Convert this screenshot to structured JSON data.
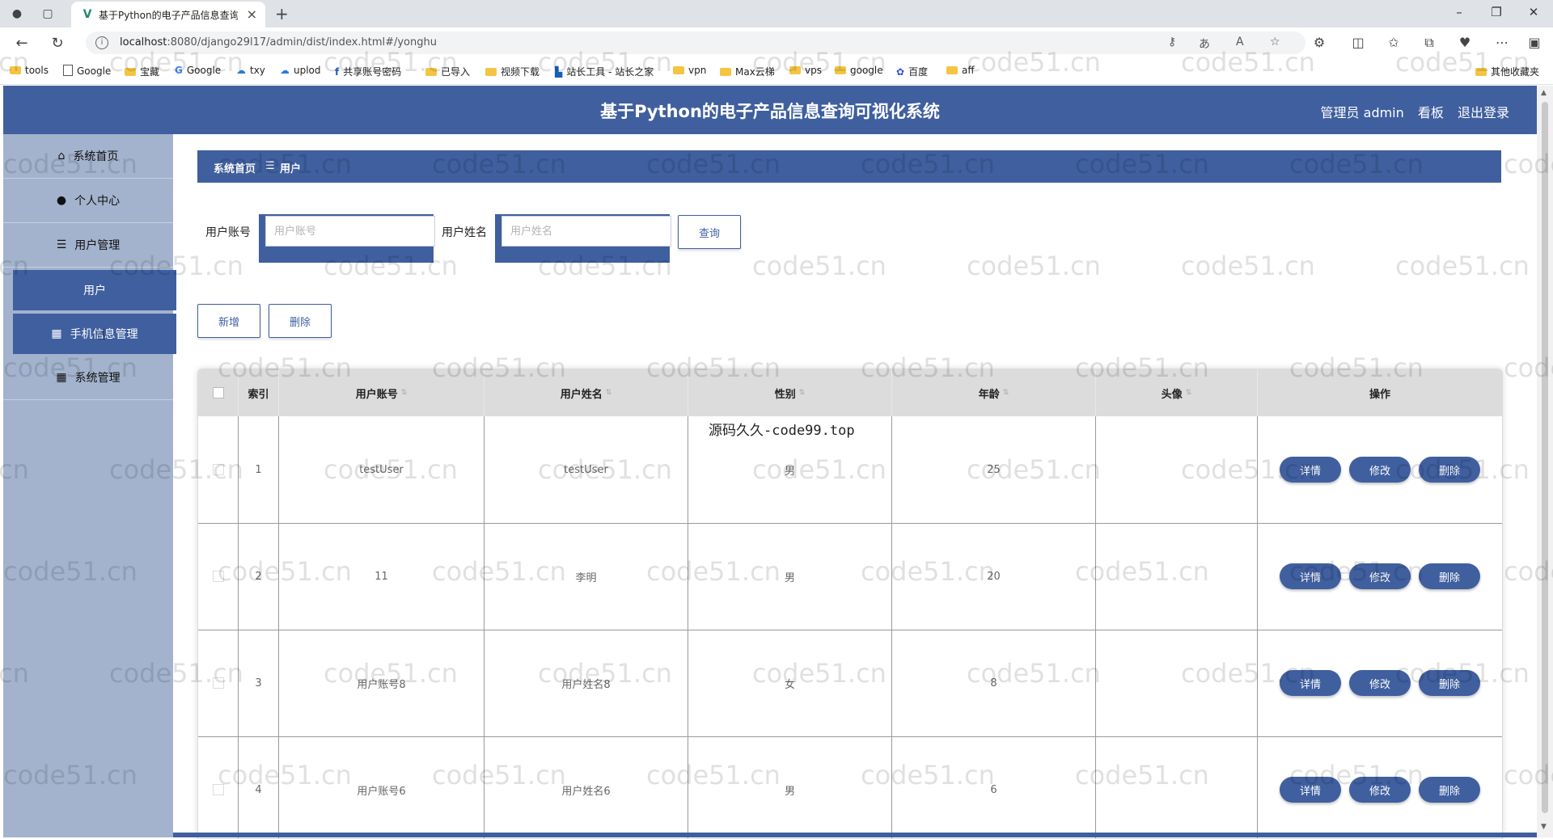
{
  "browser": {
    "tab_title": "基于Python的电子产品信息查询可视化系统",
    "url_host": "localhost",
    "url_rest": ":8080/django29l17/admin/dist/index.html#/yonghu",
    "bookmarks": [
      "tools",
      "Google",
      "宝藏",
      "Google",
      "txy",
      "uplod",
      "共享账号密码",
      "已导入",
      "视频下载",
      "站长工具 - 站长之家",
      "vpn",
      "Max云梯",
      "vps",
      "google",
      "百度",
      "aff"
    ],
    "other_bookmarks": "其他收藏夹"
  },
  "header": {
    "title": "基于Python的电子产品信息查询可视化系统",
    "user": "管理员 admin",
    "board": "看板",
    "logout": "退出登录"
  },
  "sidebar": {
    "items": [
      {
        "label": "系统首页",
        "icon": "home-icon"
      },
      {
        "label": "个人中心",
        "icon": "user-icon"
      },
      {
        "label": "用户管理",
        "icon": "list-icon"
      },
      {
        "label": "用户",
        "icon": ""
      },
      {
        "label": "手机信息管理",
        "icon": "grid-icon"
      },
      {
        "label": "系统管理",
        "icon": "grid-icon"
      }
    ]
  },
  "breadcrumb": {
    "home": "系统首页",
    "sep": "☰",
    "current": "用户"
  },
  "search": {
    "account_label": "用户账号",
    "account_placeholder": "用户账号",
    "name_label": "用户姓名",
    "name_placeholder": "用户姓名",
    "query_button": "查询"
  },
  "actions": {
    "add": "新增",
    "delete": "删除"
  },
  "table": {
    "columns": [
      "索引",
      "用户账号",
      "用户姓名",
      "性别",
      "年龄",
      "头像",
      "操作"
    ],
    "rows": [
      {
        "index": "1",
        "account": "testUser",
        "name": "testUser",
        "gender": "男",
        "age": "25"
      },
      {
        "index": "2",
        "account": "11",
        "name": "李明",
        "gender": "男",
        "age": "20"
      },
      {
        "index": "3",
        "account": "用户账号8",
        "name": "用户姓名8",
        "gender": "女",
        "age": "8"
      },
      {
        "index": "4",
        "account": "用户账号6",
        "name": "用户姓名6",
        "gender": "男",
        "age": "6"
      }
    ],
    "row_actions": {
      "detail": "详情",
      "edit": "修改",
      "delete": "删除"
    }
  },
  "overlay_note": "源码久久-code99.top",
  "watermark": "code51.cn",
  "colors": {
    "primary": "#3f5f9f",
    "sidebar": "#a3b3cd"
  }
}
